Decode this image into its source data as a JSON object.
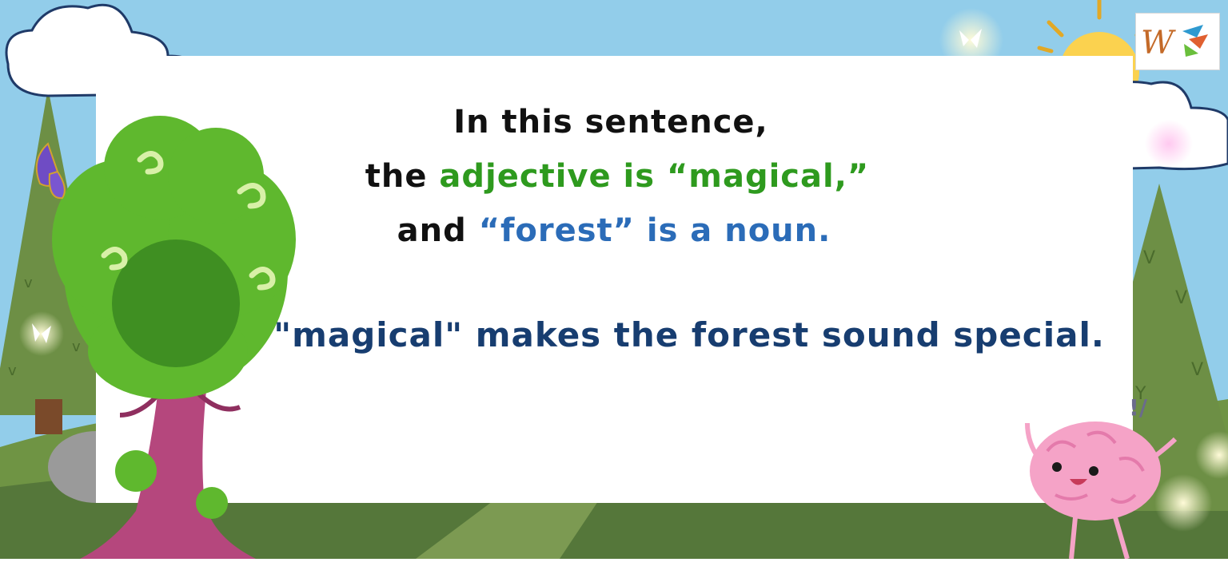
{
  "lesson": {
    "line1": "In this sentence,",
    "line2": {
      "pre": "the ",
      "adjective": "adjective is “magical,”"
    },
    "line3": {
      "pre": "and ",
      "noun": "“forest” is a noun."
    },
    "line4": "\"magical\" makes the forest sound special."
  },
  "colors": {
    "sky": "#92cdea",
    "card": "#ffffff",
    "text_dark": "#111111",
    "adjective": "#2e9a1e",
    "noun": "#2b6cb8",
    "note": "#173d70",
    "grass": "#5a7a35"
  },
  "icons": {
    "tree": "swirly-tree-icon",
    "sun": "sun-icon",
    "brain": "brain-character-icon",
    "butterfly": "butterfly-icon",
    "logo": "logo-icon"
  }
}
